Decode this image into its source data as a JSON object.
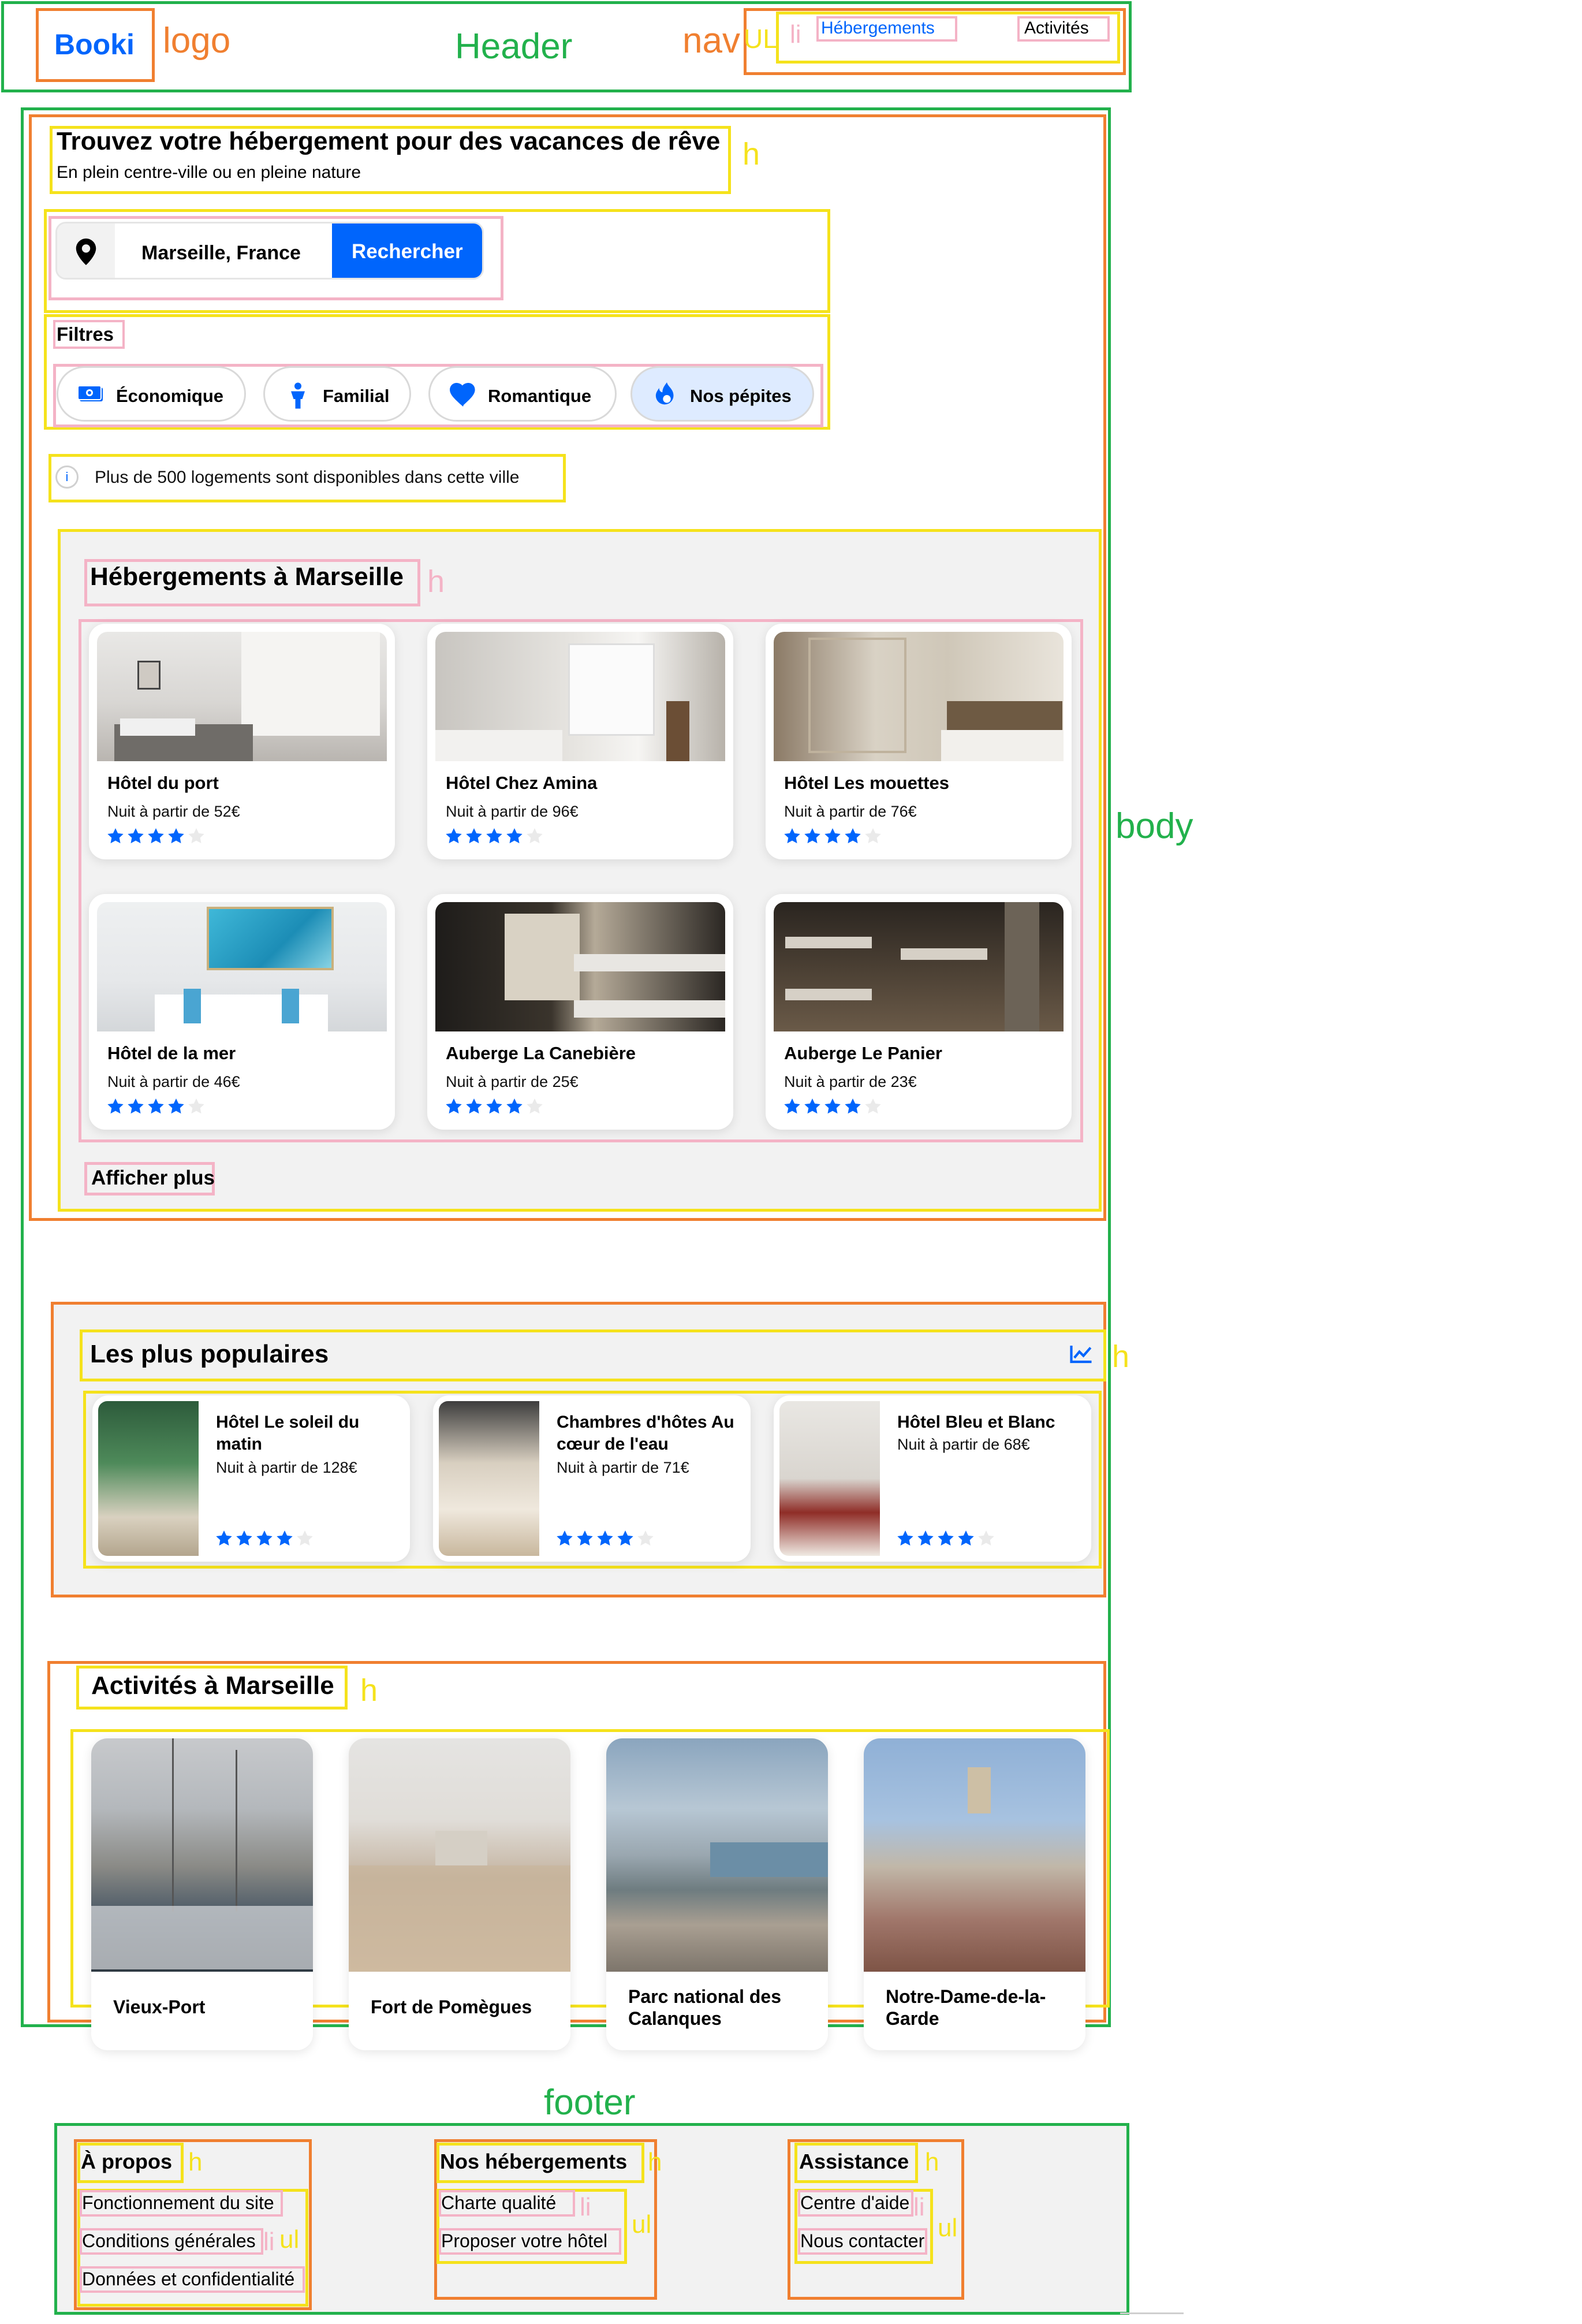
{
  "annotations": {
    "header": "Header",
    "logo": "logo",
    "nav": "nav",
    "ul": "UL",
    "li": "li",
    "body": "body",
    "footer": "footer",
    "h": "h",
    "ul_lower": "ul"
  },
  "header": {
    "logo_text_1": "Boo",
    "logo_text_2": "ki",
    "nav_items": [
      "Hébergements",
      "Activités"
    ]
  },
  "hero": {
    "title": "Trouvez votre hébergement pour des vacances de rêve",
    "subtitle": "En plein centre-ville ou en pleine nature"
  },
  "search": {
    "location": "Marseille, France",
    "button": "Rechercher"
  },
  "filters": {
    "title": "Filtres",
    "items": [
      "Économique",
      "Familial",
      "Romantique",
      "Nos pépites"
    ]
  },
  "info": {
    "icon_text": "i",
    "text": "Plus de 500 logements sont disponibles dans cette ville"
  },
  "hebergements": {
    "title": "Hébergements à Marseille",
    "cards": [
      {
        "name": "Hôtel du port",
        "price": "Nuit à partir de 52€",
        "rating": 4
      },
      {
        "name": "Hôtel Chez Amina",
        "price": "Nuit à partir de 96€",
        "rating": 4
      },
      {
        "name": "Hôtel Les mouettes",
        "price": "Nuit à partir de 76€",
        "rating": 4
      },
      {
        "name": "Hôtel de la mer",
        "price": "Nuit à partir de 46€",
        "rating": 4
      },
      {
        "name": "Auberge La Canebière",
        "price": "Nuit à partir de 25€",
        "rating": 4
      },
      {
        "name": "Auberge Le Panier",
        "price": "Nuit à partir de 23€",
        "rating": 4
      }
    ],
    "more": "Afficher plus"
  },
  "populaires": {
    "title": "Les plus populaires",
    "cards": [
      {
        "name": "Hôtel Le soleil du matin",
        "price": "Nuit à partir de 128€",
        "rating": 4
      },
      {
        "name": "Chambres d'hôtes Au cœur de l'eau",
        "price": "Nuit à partir de 71€",
        "rating": 4
      },
      {
        "name": "Hôtel Bleu et Blanc",
        "price": "Nuit à partir de 68€",
        "rating": 4
      }
    ]
  },
  "activites": {
    "title": "Activités à Marseille",
    "cards": [
      "Vieux-Port",
      "Fort de Pomègues",
      "Parc national des Calanques",
      "Notre-Dame-de-la-Garde"
    ]
  },
  "footer": {
    "columns": [
      {
        "title": "À propos",
        "links": [
          "Fonctionnement du site",
          "Conditions générales",
          "Données et confidentialité"
        ]
      },
      {
        "title": "Nos hébergements",
        "links": [
          "Charte qualité",
          "Proposer votre hôtel"
        ]
      },
      {
        "title": "Assistance",
        "links": [
          "Centre d'aide",
          "Nous contacter"
        ]
      }
    ]
  },
  "colors": {
    "accent": "#0065fc",
    "star_empty": "#eaeaea",
    "nos_pepites_bg": "#deebff"
  }
}
